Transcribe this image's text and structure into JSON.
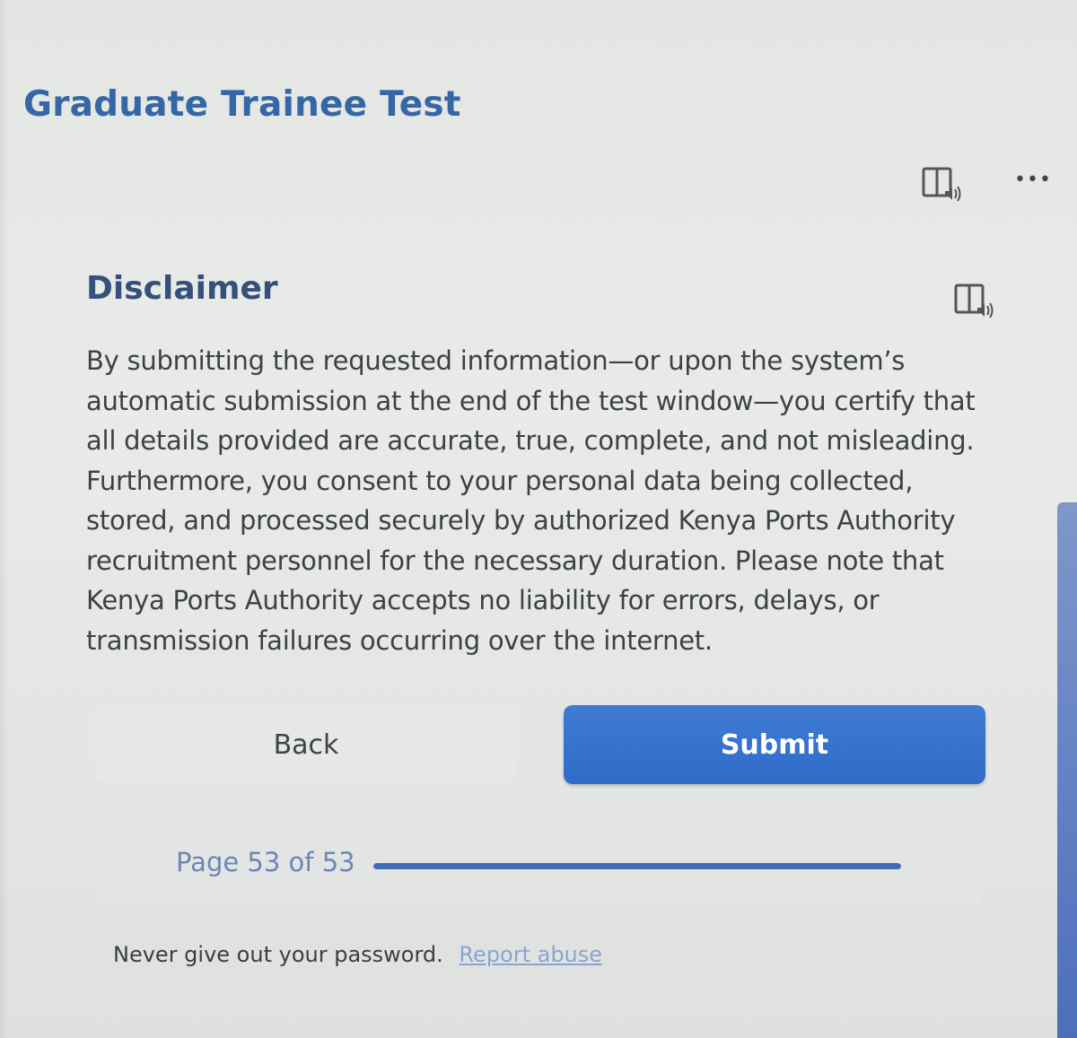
{
  "form": {
    "title": "Graduate Trainee Test"
  },
  "toolbar": {
    "reader_icon": "immersive-reader-icon",
    "more_label": "•••"
  },
  "section": {
    "title": "Disclaimer",
    "reader_icon": "immersive-reader-icon",
    "body": "By submitting the requested information—or upon the system’s automatic submission at the end of the test window—you certify that all details provided are accurate, true, complete, and not misleading. Furthermore, you consent to your personal data being collected, stored, and processed securely by authorized Kenya Ports Authority recruitment personnel for the necessary duration. Please note that Kenya Ports Authority accepts no liability for errors, delays, or transmission failures occurring over the internet."
  },
  "buttons": {
    "back_label": "Back",
    "submit_label": "Submit"
  },
  "progress": {
    "label": "Page 53 of 53",
    "current_page": 53,
    "total_pages": 53,
    "fraction": 1.0
  },
  "footer": {
    "note": "Never give out your password.",
    "link_label": "Report abuse"
  },
  "colors": {
    "accent": "#2f6cc8",
    "title": "#3567a7",
    "heading": "#35507a",
    "progress_fill": "#3e6cb6"
  }
}
